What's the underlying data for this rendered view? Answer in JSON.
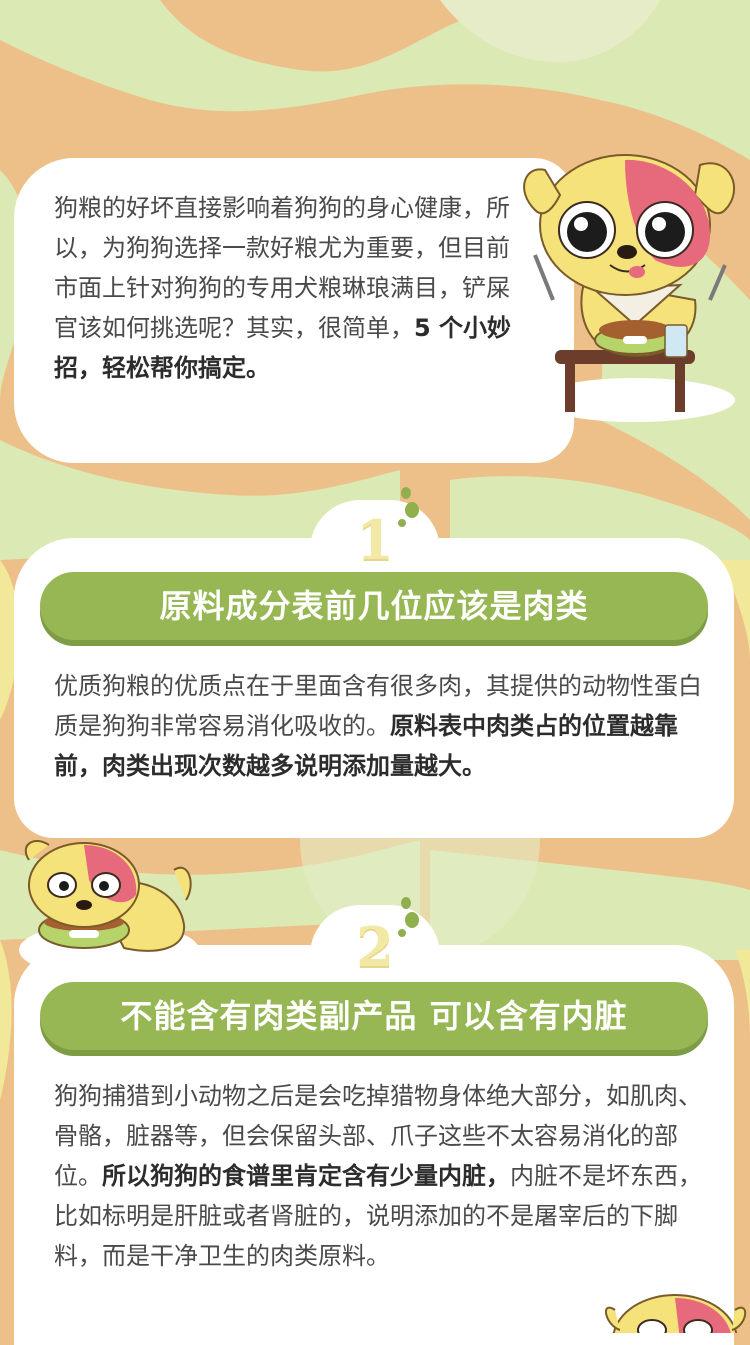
{
  "intro": {
    "text": "狗粮的好坏直接影响着狗狗的身心健康，所以，为狗狗选择一款好粮尤为重要，但目前市面上针对狗狗的专用犬粮琳琅满目，铲屎官该如何挑选呢？其实，很简单，",
    "bold": "5 个小妙招，轻松帮你搞定。"
  },
  "sections": [
    {
      "number": "1",
      "title": "原料成分表前几位应该是肉类",
      "text": "优质狗粮的优质点在于里面含有很多肉，其提供的动物性蛋白质是狗狗非常容易消化吸收的。",
      "bold": "原料表中肉类占的位置越靠前，肉类出现次数越多说明添加量越大。",
      "text_after": ""
    },
    {
      "number": "2",
      "title": "不能含有肉类副产品  可以含有内脏",
      "text": "狗狗捕猎到小动物之后是会吃掉猎物身体绝大部分，如肌肉、骨骼，脏器等，但会保留头部、爪子这些不太容易消化的部位。",
      "bold": "所以狗狗的食谱里肯定含有少量内脏，",
      "text_after": "内脏不是坏东西，比如标明是肝脏或者肾脏的，说明添加的不是屠宰后的下脚料，而是干净卫生的肉类原料。"
    }
  ],
  "colors": {
    "background_orange": "#eec089",
    "blob_green": "#dbe9b4",
    "banner_green": "#97b755",
    "number_yellow": "#f3e9a6",
    "dog_yellow": "#f6e27a",
    "dog_pink": "#e66a7c"
  },
  "icons": [
    "dog-eating-mascot",
    "dog-bowl-mascot",
    "dog-peek-mascot"
  ]
}
